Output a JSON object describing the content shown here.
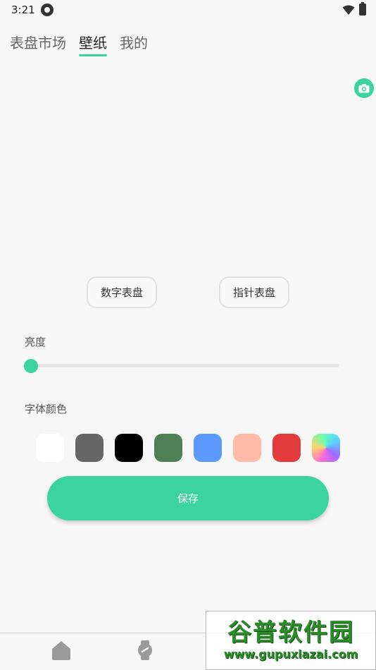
{
  "status_bar": {
    "time": "3:21",
    "notification_icon": "q-notification-icon",
    "wifi_icon": "wifi-icon",
    "battery_icon": "battery-charging-icon"
  },
  "tabs": [
    {
      "label": "表盘市场",
      "active": false
    },
    {
      "label": "壁纸",
      "active": true
    },
    {
      "label": "我的",
      "active": false
    }
  ],
  "camera": {
    "icon": "camera-icon"
  },
  "dial_types": {
    "digital": "数字表盘",
    "analog": "指针表盘"
  },
  "brightness": {
    "label": "亮度",
    "value": 0.0
  },
  "font_color": {
    "label": "字体颜色",
    "swatches": [
      "#ffffff",
      "#666666",
      "#000000",
      "#4e7f55",
      "#5b99ff",
      "#ffbba8",
      "#e23b3b",
      "gradient"
    ]
  },
  "save_label": "保存",
  "bottom_nav": {
    "items": [
      "home-icon",
      "watch-icon"
    ]
  },
  "watermark": {
    "title": "谷普软件园",
    "url": "www.gupuxiazai.com"
  },
  "theme": {
    "accent": "#3bd3a0"
  }
}
